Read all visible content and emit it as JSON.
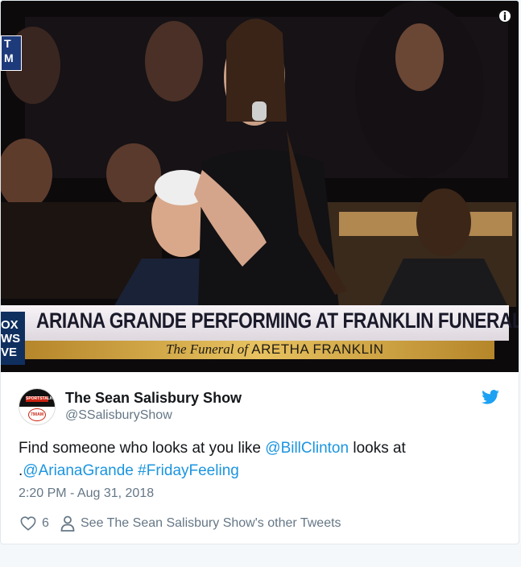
{
  "media": {
    "chyron_headline": "ARIANA GRANDE PERFORMING AT FRANKLIN FUNERAL",
    "chyron_sub_prefix": "The Funeral of",
    "chyron_sub_name": "ARETHA FRANKLIN",
    "network_logo_lines": [
      "OX",
      "WS",
      "VE"
    ],
    "corner_badge_lines": [
      "T",
      "M"
    ],
    "info_icon_glyph": "i"
  },
  "tweet": {
    "author_name": "The Sean Salisbury Show",
    "author_handle": "@SSalisburyShow",
    "avatar_band_text": "SPORTSTALK",
    "avatar_circle_text": "790AM",
    "text_before": "Find someone who looks at you like ",
    "mention_1": "@BillClinton",
    "text_middle": " looks at .",
    "mention_2": "@ArianaGrande",
    "text_space": " ",
    "hashtag": "#FridayFeeling",
    "timestamp": "2:20 PM - Aug 31, 2018",
    "like_count": "6",
    "other_tweets_label": "See The Sean Salisbury Show's other Tweets"
  },
  "colors": {
    "link": "#1b95e0",
    "twitter_blue": "#1da1f2",
    "secondary_text": "#657786",
    "primary_text": "#14171a"
  },
  "icons": {
    "brand": "twitter-bird-icon",
    "like": "heart-icon",
    "profile": "person-icon",
    "info": "info-icon"
  }
}
